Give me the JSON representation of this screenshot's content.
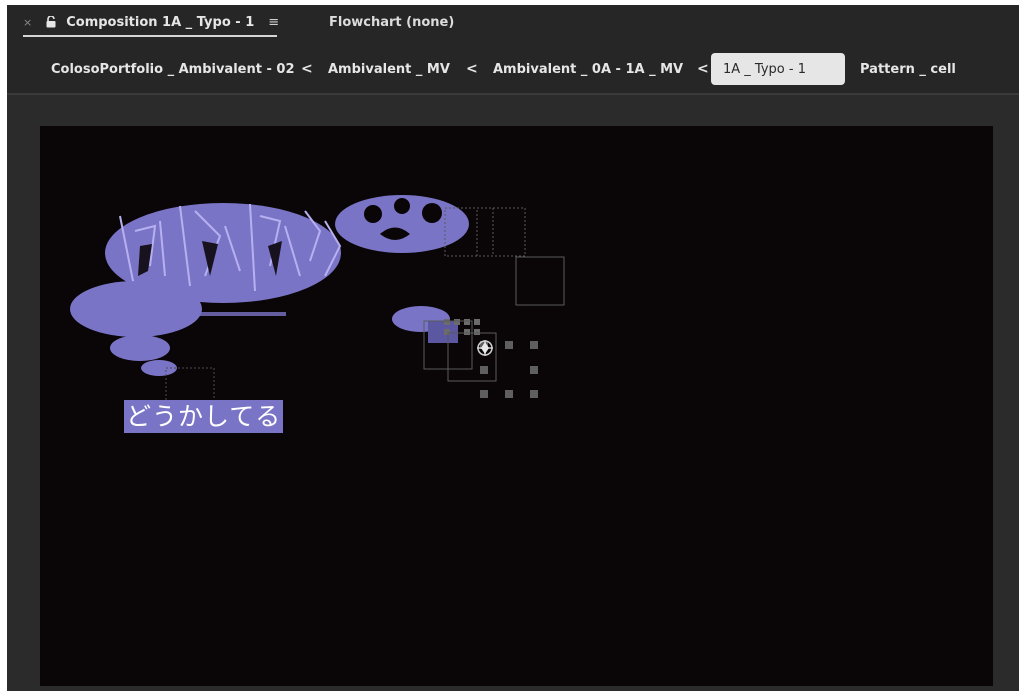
{
  "tabs": {
    "composition_label": "Composition 1A _ Typo - 1",
    "flowchart_label": "Flowchart (none)",
    "close_glyph": "×",
    "menu_glyph": "≡",
    "lock_icon": "lock-open-icon",
    "menu_icon": "hamburger-menu-icon"
  },
  "breadcrumb": {
    "items": [
      {
        "label": "ColosoPortfolio _ Ambivalent - 02",
        "active": false
      },
      {
        "label": "Ambivalent _ MV",
        "active": false
      },
      {
        "label": "Ambivalent _ 0A - 1A _ MV",
        "active": false
      },
      {
        "label": "1A _ Typo - 1",
        "active": true
      },
      {
        "label": "Pattern _ cell",
        "active": false
      }
    ],
    "separator_glyph": "<",
    "separator_icon": "chevron-left-icon"
  },
  "viewer": {
    "caption_text": "どうかしてる",
    "colors": {
      "panel_bg": "#262626",
      "canvas_bg": "#0a0506",
      "accent_purple": "#7a74c7",
      "active_crumb_bg": "#e6e6e6",
      "handle_gray": "#5f5f5f"
    }
  }
}
